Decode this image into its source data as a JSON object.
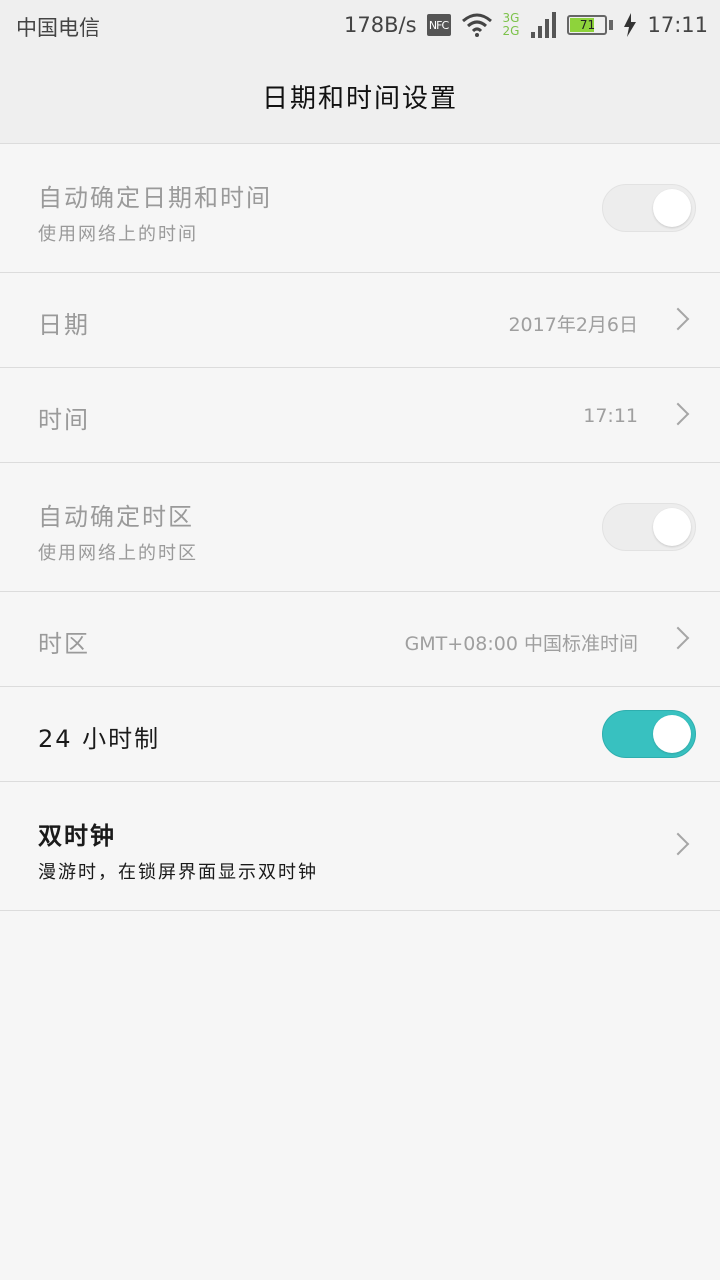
{
  "status_bar": {
    "carrier": "中国电信",
    "speed": "178B/s",
    "nfc": "NFC",
    "net_top": "3G",
    "net_bottom": "2G",
    "battery": "71",
    "battery_level": 0.71,
    "time": "17:11",
    "icons": [
      "nfc-icon",
      "wifi-icon",
      "signal-icon",
      "battery-icon",
      "charging-icon"
    ]
  },
  "header": {
    "title": "日期和时间设置"
  },
  "settings": {
    "auto_datetime": {
      "title": "自动确定日期和时间",
      "subtitle": "使用网络上的时间",
      "enabled": false
    },
    "date": {
      "title": "日期",
      "value": "2017年2月6日"
    },
    "time": {
      "title": "时间",
      "value": "17:11"
    },
    "auto_timezone": {
      "title": "自动确定时区",
      "subtitle": "使用网络上的时区",
      "enabled": false
    },
    "timezone": {
      "title": "时区",
      "value": "GMT+08:00 中国标准时间"
    },
    "hour24": {
      "title": "24 小时制",
      "enabled": true
    },
    "dual_clock": {
      "title": "双时钟",
      "subtitle": "漫游时，在锁屏界面显示双时钟"
    }
  },
  "colors": {
    "toggle_on": "#38c1c0",
    "toggle_off": "#ededed",
    "battery_fill": "#8ed33b"
  }
}
